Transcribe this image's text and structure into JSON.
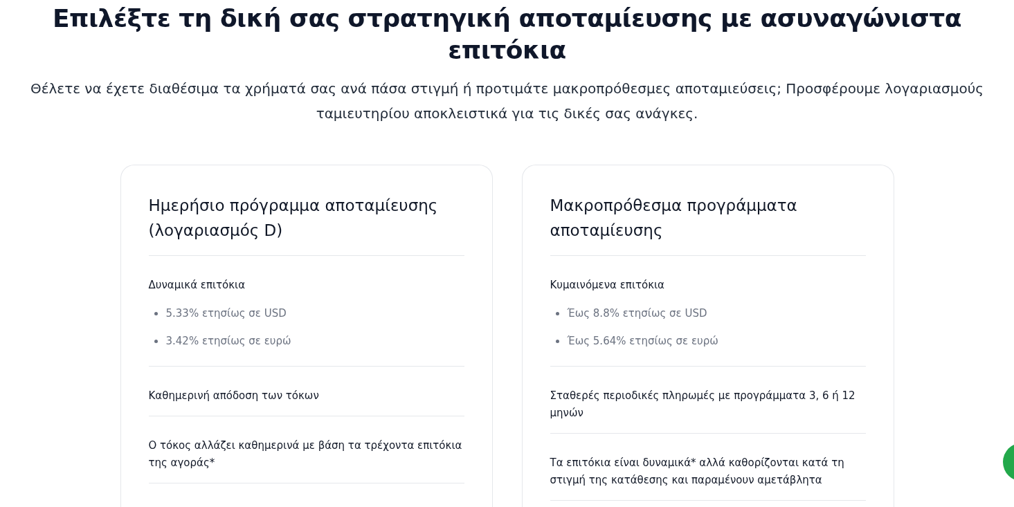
{
  "heading": "Επιλέξτε τη δική σας στρατηγική αποταμίευσης με ασυναγώνιστα επιτόκια",
  "intro": "Θέλετε να έχετε διαθέσιμα τα χρήματά σας ανά πάσα στιγμή ή προτιμάτε μακροπρόθεσμες αποταμιεύσεις; Προσφέρουμε λογαριασμούς ταμιευτηρίου αποκλειστικά για τις δικές σας ανάγκες.",
  "plans": [
    {
      "title": "Ημερήσιο πρόγραμμα αποταμίευσης (λογαριασμός D)",
      "features": [
        {
          "kind": "rates",
          "label": "Δυναμικά επιτόκια",
          "bullets": [
            "5.33% ετησίως σε USD",
            "3.42% ετησίως σε ευρώ"
          ]
        },
        {
          "kind": "text",
          "label": "Καθημερινή απόδοση των τόκων"
        },
        {
          "kind": "text",
          "label": "Ο τόκος αλλάζει καθημερινά με βάση τα τρέχοντα επιτόκια της αγοράς*"
        }
      ]
    },
    {
      "title": "Μακροπρόθεσμα προγράμματα αποταμίευσης",
      "features": [
        {
          "kind": "rates",
          "label": "Κυμαινόμενα επιτόκια",
          "bullets": [
            "Έως 8.8% ετησίως σε USD",
            "Έως 5.64% ετησίως σε ευρώ"
          ]
        },
        {
          "kind": "text",
          "label": "Σταθερές περιοδικές πληρωμές με προγράμματα 3, 6 ή 12 μηνών"
        },
        {
          "kind": "text",
          "label": "Τα επιτόκια είναι δυναμικά* αλλά καθορίζονται κατά τη στιγμή της κατάθεσης και παραμένουν αμετάβλητα"
        }
      ]
    }
  ]
}
